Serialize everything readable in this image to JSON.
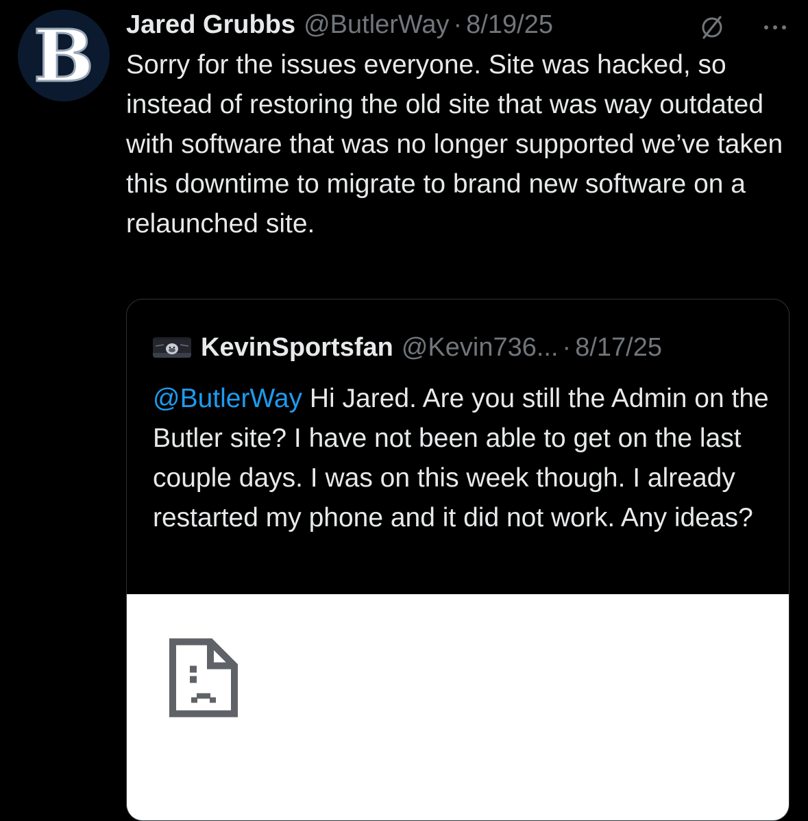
{
  "tweet": {
    "name": "Jared Grubbs",
    "handle": "@ButlerWay",
    "separator": "·",
    "date": "8/19/25",
    "text": "Sorry for the issues everyone. Site was hacked, so instead of restoring the old site that was way outdated with software that was no longer supported we’ve taken this downtime to migrate to brand new software on a relaunched site.",
    "avatar_letter": "B"
  },
  "quoted": {
    "name": "KevinSportsfan",
    "handle": "@Kevin736...",
    "separator": "·",
    "date": "8/17/25",
    "mention": "@ButlerWay",
    "text": " Hi Jared. Are you still the Admin on the Butler site? I have not been able to get on the last couple days. I was on this week though. I already restarted my phone and it did not work. Any ideas?"
  },
  "icons": {
    "header_actions": [
      "grok-icon",
      "more-icon"
    ],
    "media_placeholder": "broken-image-icon"
  },
  "colors": {
    "background": "#000000",
    "text": "#e7e9ea",
    "secondary": "#71767b",
    "mention": "#1d9bf0",
    "border": "#2f3336"
  }
}
